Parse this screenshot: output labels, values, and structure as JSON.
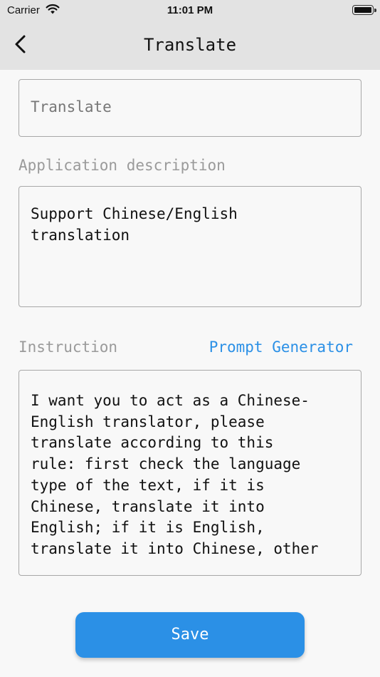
{
  "status_bar": {
    "carrier": "Carrier",
    "time": "11:01 PM",
    "icons": [
      "wifi-icon",
      "battery-icon"
    ]
  },
  "nav": {
    "title": "Translate",
    "back_icon": "chevron-left-icon"
  },
  "form": {
    "app_name_value": "Translate",
    "description_label": "Application description",
    "description_value": "Support Chinese/English\ntranslation",
    "instruction_label": "Instruction",
    "prompt_generator_label": "Prompt Generator",
    "instruction_value": "I want you to act as a Chinese-\nEnglish translator, please\ntranslate according to this\nrule: first check the language\ntype of the text, if it is\nChinese, translate it into\nEnglish; if it is English,\ntranslate it into Chinese, other"
  },
  "save_label": "Save",
  "colors": {
    "accent": "#2b90e6",
    "nav_background": "#e3e3e3",
    "page_background": "#f8f8f8",
    "muted_label": "#9a9a9a"
  }
}
